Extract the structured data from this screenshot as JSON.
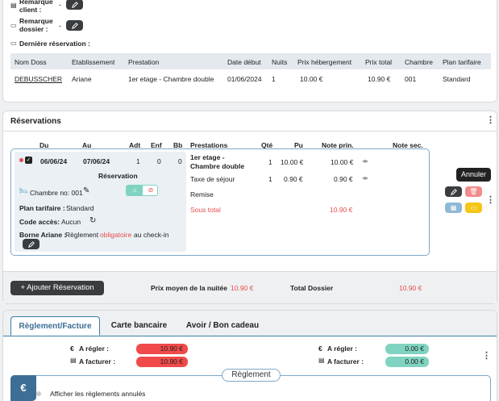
{
  "top": {
    "remarque_client_label": "Remarque client :",
    "remarque_client_value": "-",
    "remarque_dossier_label": "Remarque dossier :",
    "remarque_dossier_value": "-",
    "derniere_reservation_label": "Dernière réservation :"
  },
  "last_table": {
    "headers": [
      "Nom Doss",
      "Etablissement",
      "Prestation",
      "Date début",
      "Nuits",
      "Prix hébergement",
      "Prix total",
      "Chambre",
      "Plan tarifaire"
    ],
    "row": [
      "DEBUSSCHER",
      "Ariane",
      "1er etage - Chambre double",
      "01/06/2024",
      "1",
      "10.00 €",
      "10.90 €",
      "001",
      "Standard"
    ]
  },
  "reservations": {
    "title": "Réservations",
    "headers": [
      "Du",
      "Au",
      "Adt",
      "Enf",
      "Bb",
      "Prestations",
      "Qté",
      "Pu",
      "Note prin.",
      "Note sec."
    ],
    "du": "06/06/24",
    "au": "07/06/24",
    "adt": "1",
    "enf": "0",
    "bb": "0",
    "reservation_label": "Réservation",
    "chambre_label": "Chambre no: 001",
    "plan_label": "Plan tarifaire :",
    "plan_value": "Standard",
    "code_label": "Code accès:",
    "code_value": "Aucun",
    "borne_label": "Borne Ariane :",
    "borne_text_1": "Règlement",
    "borne_text_2": "obligatoire",
    "borne_text_3": "au check-in",
    "prestations": [
      {
        "name_1": "1er etage -",
        "name_2": "Chambre double",
        "qte": "1",
        "pu": "10.00 €",
        "note": "10.00 €"
      },
      {
        "name": "Taxe de séjour",
        "qte": "1",
        "pu": "0.90 €",
        "note": "0.90 €"
      }
    ],
    "remise_label": "Remise",
    "sous_total_label": "Sous total",
    "sous_total_value": "10.90 €",
    "tooltip": "Annuler",
    "add_button": "+ Ajouter Réservation",
    "prix_moyen_label": "Prix moyen de la nuitée",
    "prix_moyen_value": "10.90 €",
    "total_label": "Total Dossier",
    "total_value": "10.90 €"
  },
  "payment": {
    "tabs": [
      "Règlement/Facture",
      "Carte bancaire",
      "Avoir / Bon cadeau"
    ],
    "a_regler_label": "A régler :",
    "a_facturer_label": "A facturer :",
    "left_regler": "10.90 €",
    "left_facturer": "10.90 €",
    "right_regler": "0.00 €",
    "right_facturer": "0.00 €",
    "reglement_title": "Règlement",
    "afficher_label": "Afficher les règlements annulés"
  },
  "colors": {
    "accent_red": "#e84c4c",
    "pill_green": "#7fd4c1",
    "pill_red": "#f04a4a",
    "blue_border": "#3d7ea6"
  }
}
